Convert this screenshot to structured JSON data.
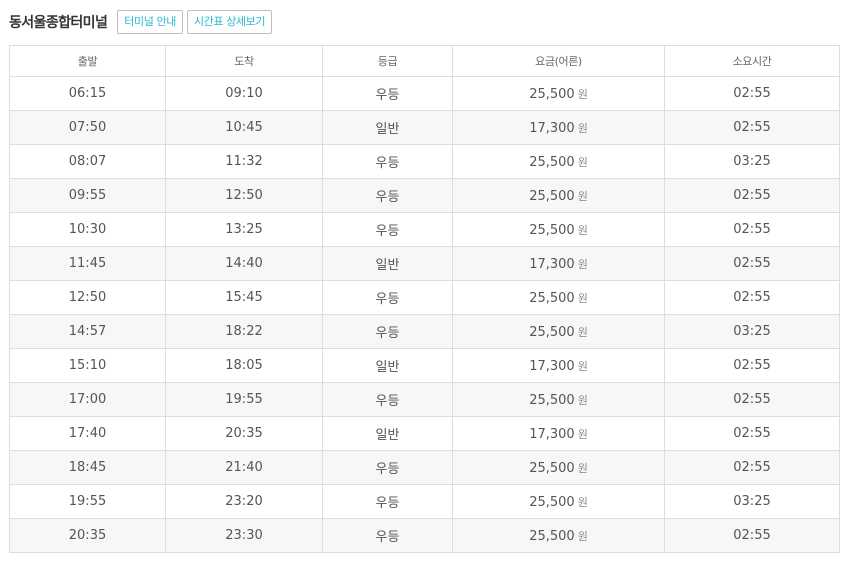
{
  "header": {
    "terminal_name": "동서울종합터미널",
    "buttons": [
      "터미널 안내",
      "시간표 상세보기"
    ]
  },
  "table": {
    "columns": [
      "출발",
      "도착",
      "등급",
      "요금(어른)",
      "소요시간"
    ],
    "currency": "원",
    "rows": [
      {
        "depart": "06:15",
        "arrive": "09:10",
        "grade": "우등",
        "fare": "25,500",
        "duration": "02:55"
      },
      {
        "depart": "07:50",
        "arrive": "10:45",
        "grade": "일반",
        "fare": "17,300",
        "duration": "02:55"
      },
      {
        "depart": "08:07",
        "arrive": "11:32",
        "grade": "우등",
        "fare": "25,500",
        "duration": "03:25"
      },
      {
        "depart": "09:55",
        "arrive": "12:50",
        "grade": "우등",
        "fare": "25,500",
        "duration": "02:55"
      },
      {
        "depart": "10:30",
        "arrive": "13:25",
        "grade": "우등",
        "fare": "25,500",
        "duration": "02:55"
      },
      {
        "depart": "11:45",
        "arrive": "14:40",
        "grade": "일반",
        "fare": "17,300",
        "duration": "02:55"
      },
      {
        "depart": "12:50",
        "arrive": "15:45",
        "grade": "우등",
        "fare": "25,500",
        "duration": "02:55"
      },
      {
        "depart": "14:57",
        "arrive": "18:22",
        "grade": "우등",
        "fare": "25,500",
        "duration": "03:25"
      },
      {
        "depart": "15:10",
        "arrive": "18:05",
        "grade": "일반",
        "fare": "17,300",
        "duration": "02:55"
      },
      {
        "depart": "17:00",
        "arrive": "19:55",
        "grade": "우등",
        "fare": "25,500",
        "duration": "02:55"
      },
      {
        "depart": "17:40",
        "arrive": "20:35",
        "grade": "일반",
        "fare": "17,300",
        "duration": "02:55"
      },
      {
        "depart": "18:45",
        "arrive": "21:40",
        "grade": "우등",
        "fare": "25,500",
        "duration": "02:55"
      },
      {
        "depart": "19:55",
        "arrive": "23:20",
        "grade": "우등",
        "fare": "25,500",
        "duration": "03:25"
      },
      {
        "depart": "20:35",
        "arrive": "23:30",
        "grade": "우등",
        "fare": "25,500",
        "duration": "02:55"
      }
    ]
  },
  "colors": {
    "accent": "#2ab8d0",
    "border": "#dddddd",
    "stripe": "#f7f7f7"
  }
}
